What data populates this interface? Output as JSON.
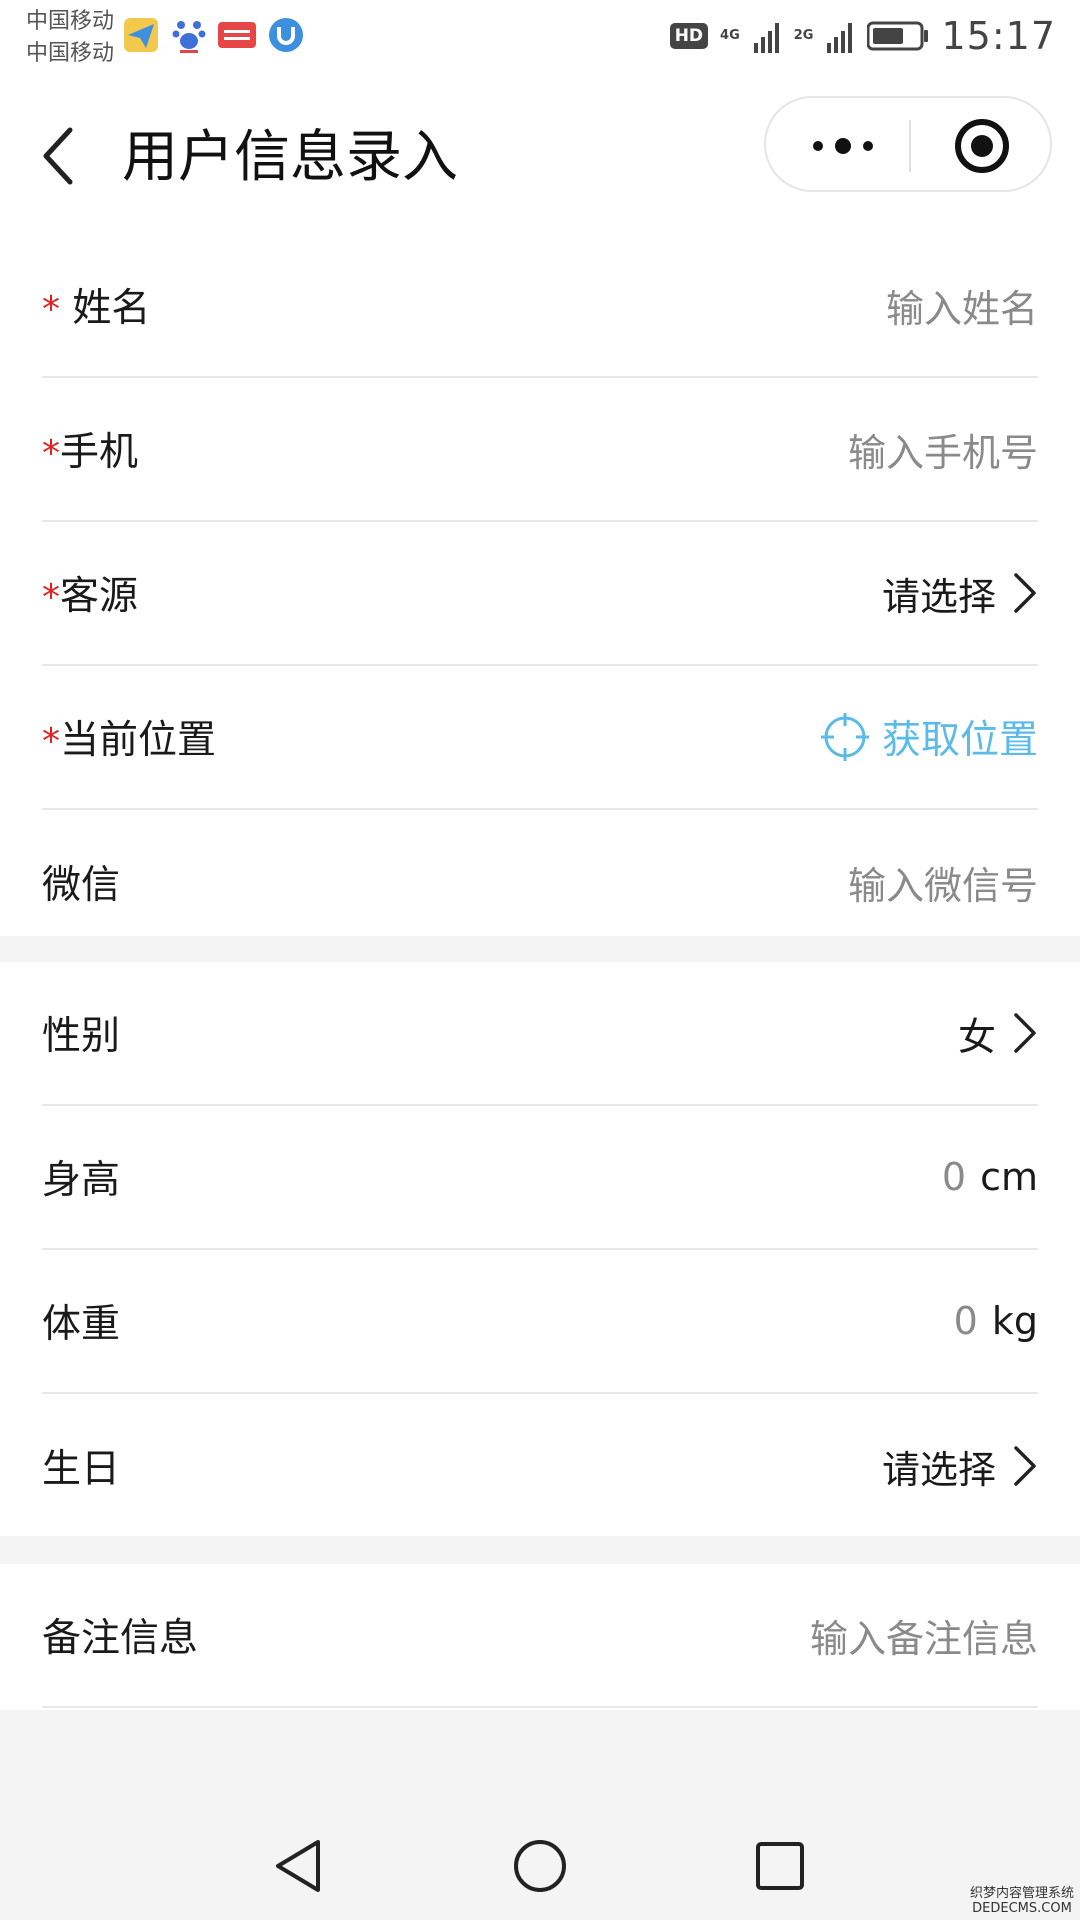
{
  "status_bar": {
    "carrier_1": "中国移动",
    "carrier_2": "中国移动",
    "hd": "HD",
    "net_1": "4G",
    "net_2": "2G",
    "time": "15:17"
  },
  "nav": {
    "title": "用户信息录入"
  },
  "form": {
    "required_mark": "*",
    "name": {
      "label": "姓名",
      "placeholder": "输入姓名"
    },
    "phone": {
      "label": "手机",
      "placeholder": "输入手机号"
    },
    "source": {
      "label": "客源",
      "value": "请选择"
    },
    "location": {
      "label": "当前位置",
      "action": "获取位置"
    },
    "wechat": {
      "label": "微信",
      "placeholder": "输入微信号"
    },
    "gender": {
      "label": "性别",
      "value": "女"
    },
    "height": {
      "label": "身高",
      "value": "0",
      "unit": "cm"
    },
    "weight": {
      "label": "体重",
      "value": "0",
      "unit": "kg"
    },
    "birthday": {
      "label": "生日",
      "value": "请选择"
    },
    "remarks": {
      "label": "备注信息",
      "placeholder": "输入备注信息"
    }
  },
  "watermark": {
    "line1": "织梦内容管理系统",
    "line2": "DEDECMS.COM"
  },
  "colors": {
    "accent": "#5bbbe8",
    "required": "#e02020",
    "placeholder": "#8a8a8a"
  }
}
